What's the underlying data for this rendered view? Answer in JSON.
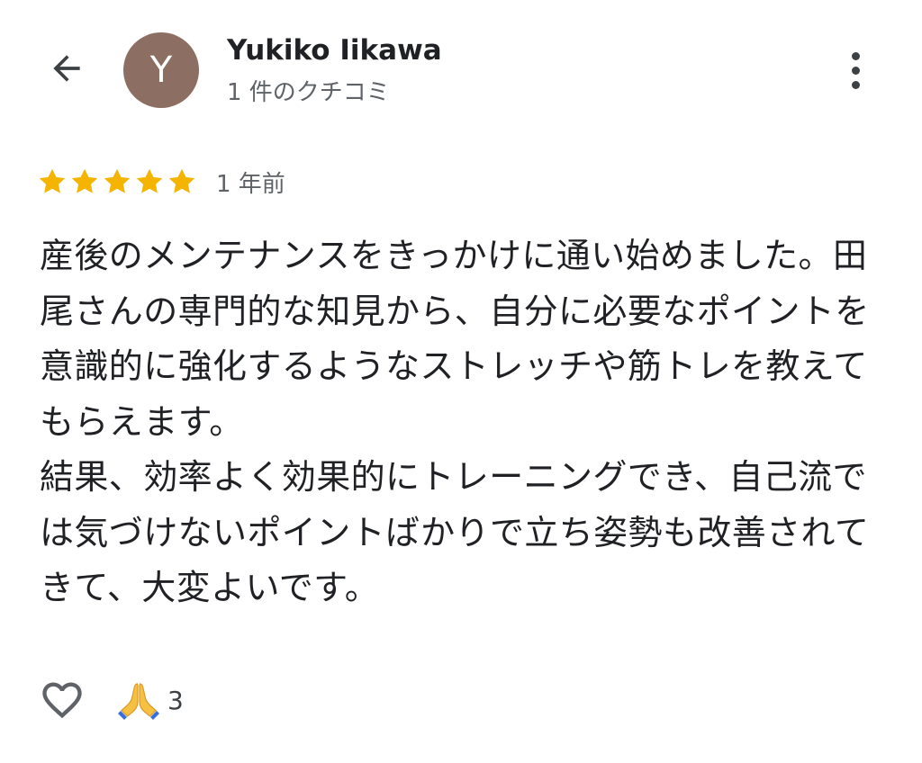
{
  "header": {
    "back_icon": "arrow-back-icon",
    "avatar_initial": "Y",
    "avatar_color": "#8d6e63",
    "user_name": "Yukiko Iikawa",
    "review_count": "1 件のクチコミ",
    "more_icon": "more-vert-icon"
  },
  "review": {
    "rating": 5,
    "max_rating": 5,
    "star_color": "#f4b400",
    "time_ago": "1 年前",
    "paragraphs": [
      "産後のメンテナンスをきっかけに通い始めました。田尾さんの専門的な知見から、自分に必要なポイントを意識的に強化するようなストレッチや筋トレを教えてもらえます。",
      "結果、効率よく効果的にトレーニングでき、自己流では気づけないポイントばかりで立ち姿勢も改善されてきて、大変よいです。"
    ]
  },
  "actions": {
    "like_icon": "heart-outline-icon",
    "reaction_icon": "folded-hands-icon",
    "reaction_count": "3"
  }
}
